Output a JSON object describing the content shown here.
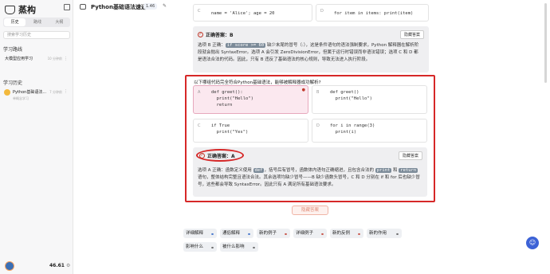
{
  "app": {
    "logo_text": "蒸构"
  },
  "sidebar": {
    "tabs": [
      {
        "label": "历史"
      },
      {
        "label": "路线"
      },
      {
        "label": "大纲"
      }
    ],
    "search_placeholder": "搜索学习历史",
    "sections": [
      {
        "title": "学习路线"
      },
      {
        "title": "学习历史"
      }
    ],
    "path_item": {
      "title": "大模型应用学习",
      "time": "10 分钟前",
      "more": "⋮"
    },
    "history_item": {
      "title": "Python基础语法...",
      "time": "7 分钟前",
      "more": "⋮",
      "sub": "单概念学习"
    },
    "credits": "46.61",
    "settings_glyph": "⚙"
  },
  "header": {
    "title": "Python基础语法速通",
    "version": "1.46",
    "edit_glyph": "✎"
  },
  "top_options": [
    {
      "letter": "C",
      "text": "name = 'Alice'; age = 20"
    },
    {
      "letter": "D",
      "text": "for item in items: print(item)"
    }
  ],
  "answer1": {
    "label": "正确答案：B",
    "hide": "隐藏答案",
    "expl_pre": "选项 B 正确：",
    "code": "if score >= 60",
    "expl_post": " 缺少末尾的冒号（:），这是条件语句的语法强制要求，Python 解释器在解析阶段就会抛出 SyntaxError。选项 A 会引发 ZeroDivisionError，但属于运行时错误而非语法错误；选项 C 和 D 都是语法合法的代码。因此，只有 B 违反了基础语法的核心规则，导致无法进入执行阶段。"
  },
  "question": "以下哪组代码完全符合Python基础语法，能够被解释器成功解析?",
  "options": [
    {
      "letter": "A",
      "text": "def greet():\n  print(\"Hello\")\n  return",
      "selected": true
    },
    {
      "letter": "B",
      "text": "def greet()\n  print(\"Hello\")"
    },
    {
      "letter": "C",
      "text": "if True\n  print(\"Yes\")"
    },
    {
      "letter": "D",
      "text": "for i in range(3)\n  print(i)"
    }
  ],
  "answer2": {
    "label": "正确答案：A",
    "hide": "隐藏答案",
    "e1": "选项 A 正确：函数定义使用 ",
    "c1": "def",
    "e2": "，括号后有冒号，函数体内语句正确缩进，且包含合法的 ",
    "c2": "print",
    "e3": " 和 ",
    "c3": "return",
    "e4": " 语句，整体结构完整且语法合法。其余选项均缺少冒号——B 缺少函数头冒号，C 和 D 分别在 if 和 for 后也缺少冒号，这些都会导致 SyntaxError。因此只有 A 满足所有基础语法要求。"
  },
  "reveal_button": "隐藏答案",
  "chips": [
    {
      "label": "详细解释",
      "icon": "⚭",
      "icon_color": "blue"
    },
    {
      "label": "通俗解释",
      "icon": "⚭",
      "icon_color": "blue"
    },
    {
      "label": "新的例子",
      "icon": "⚭",
      "icon_color": "red"
    },
    {
      "label": "详细例子",
      "icon": "⚭",
      "icon_color": "red"
    },
    {
      "label": "新的反例",
      "icon": "⚭",
      "icon_color": "red"
    },
    {
      "label": "新的作用",
      "icon": "⚭",
      "icon_color": "gray"
    },
    {
      "label": "影响什么",
      "icon": "⚭",
      "icon_color": "gray"
    },
    {
      "label": "被什么影响",
      "icon": "⚭",
      "icon_color": "gray"
    }
  ],
  "assistant_glyph": "☺",
  "colors": {
    "accent_red": "#d62828",
    "selected_bg": "#fbe8ef",
    "chip_bg": "#eef0f3"
  }
}
